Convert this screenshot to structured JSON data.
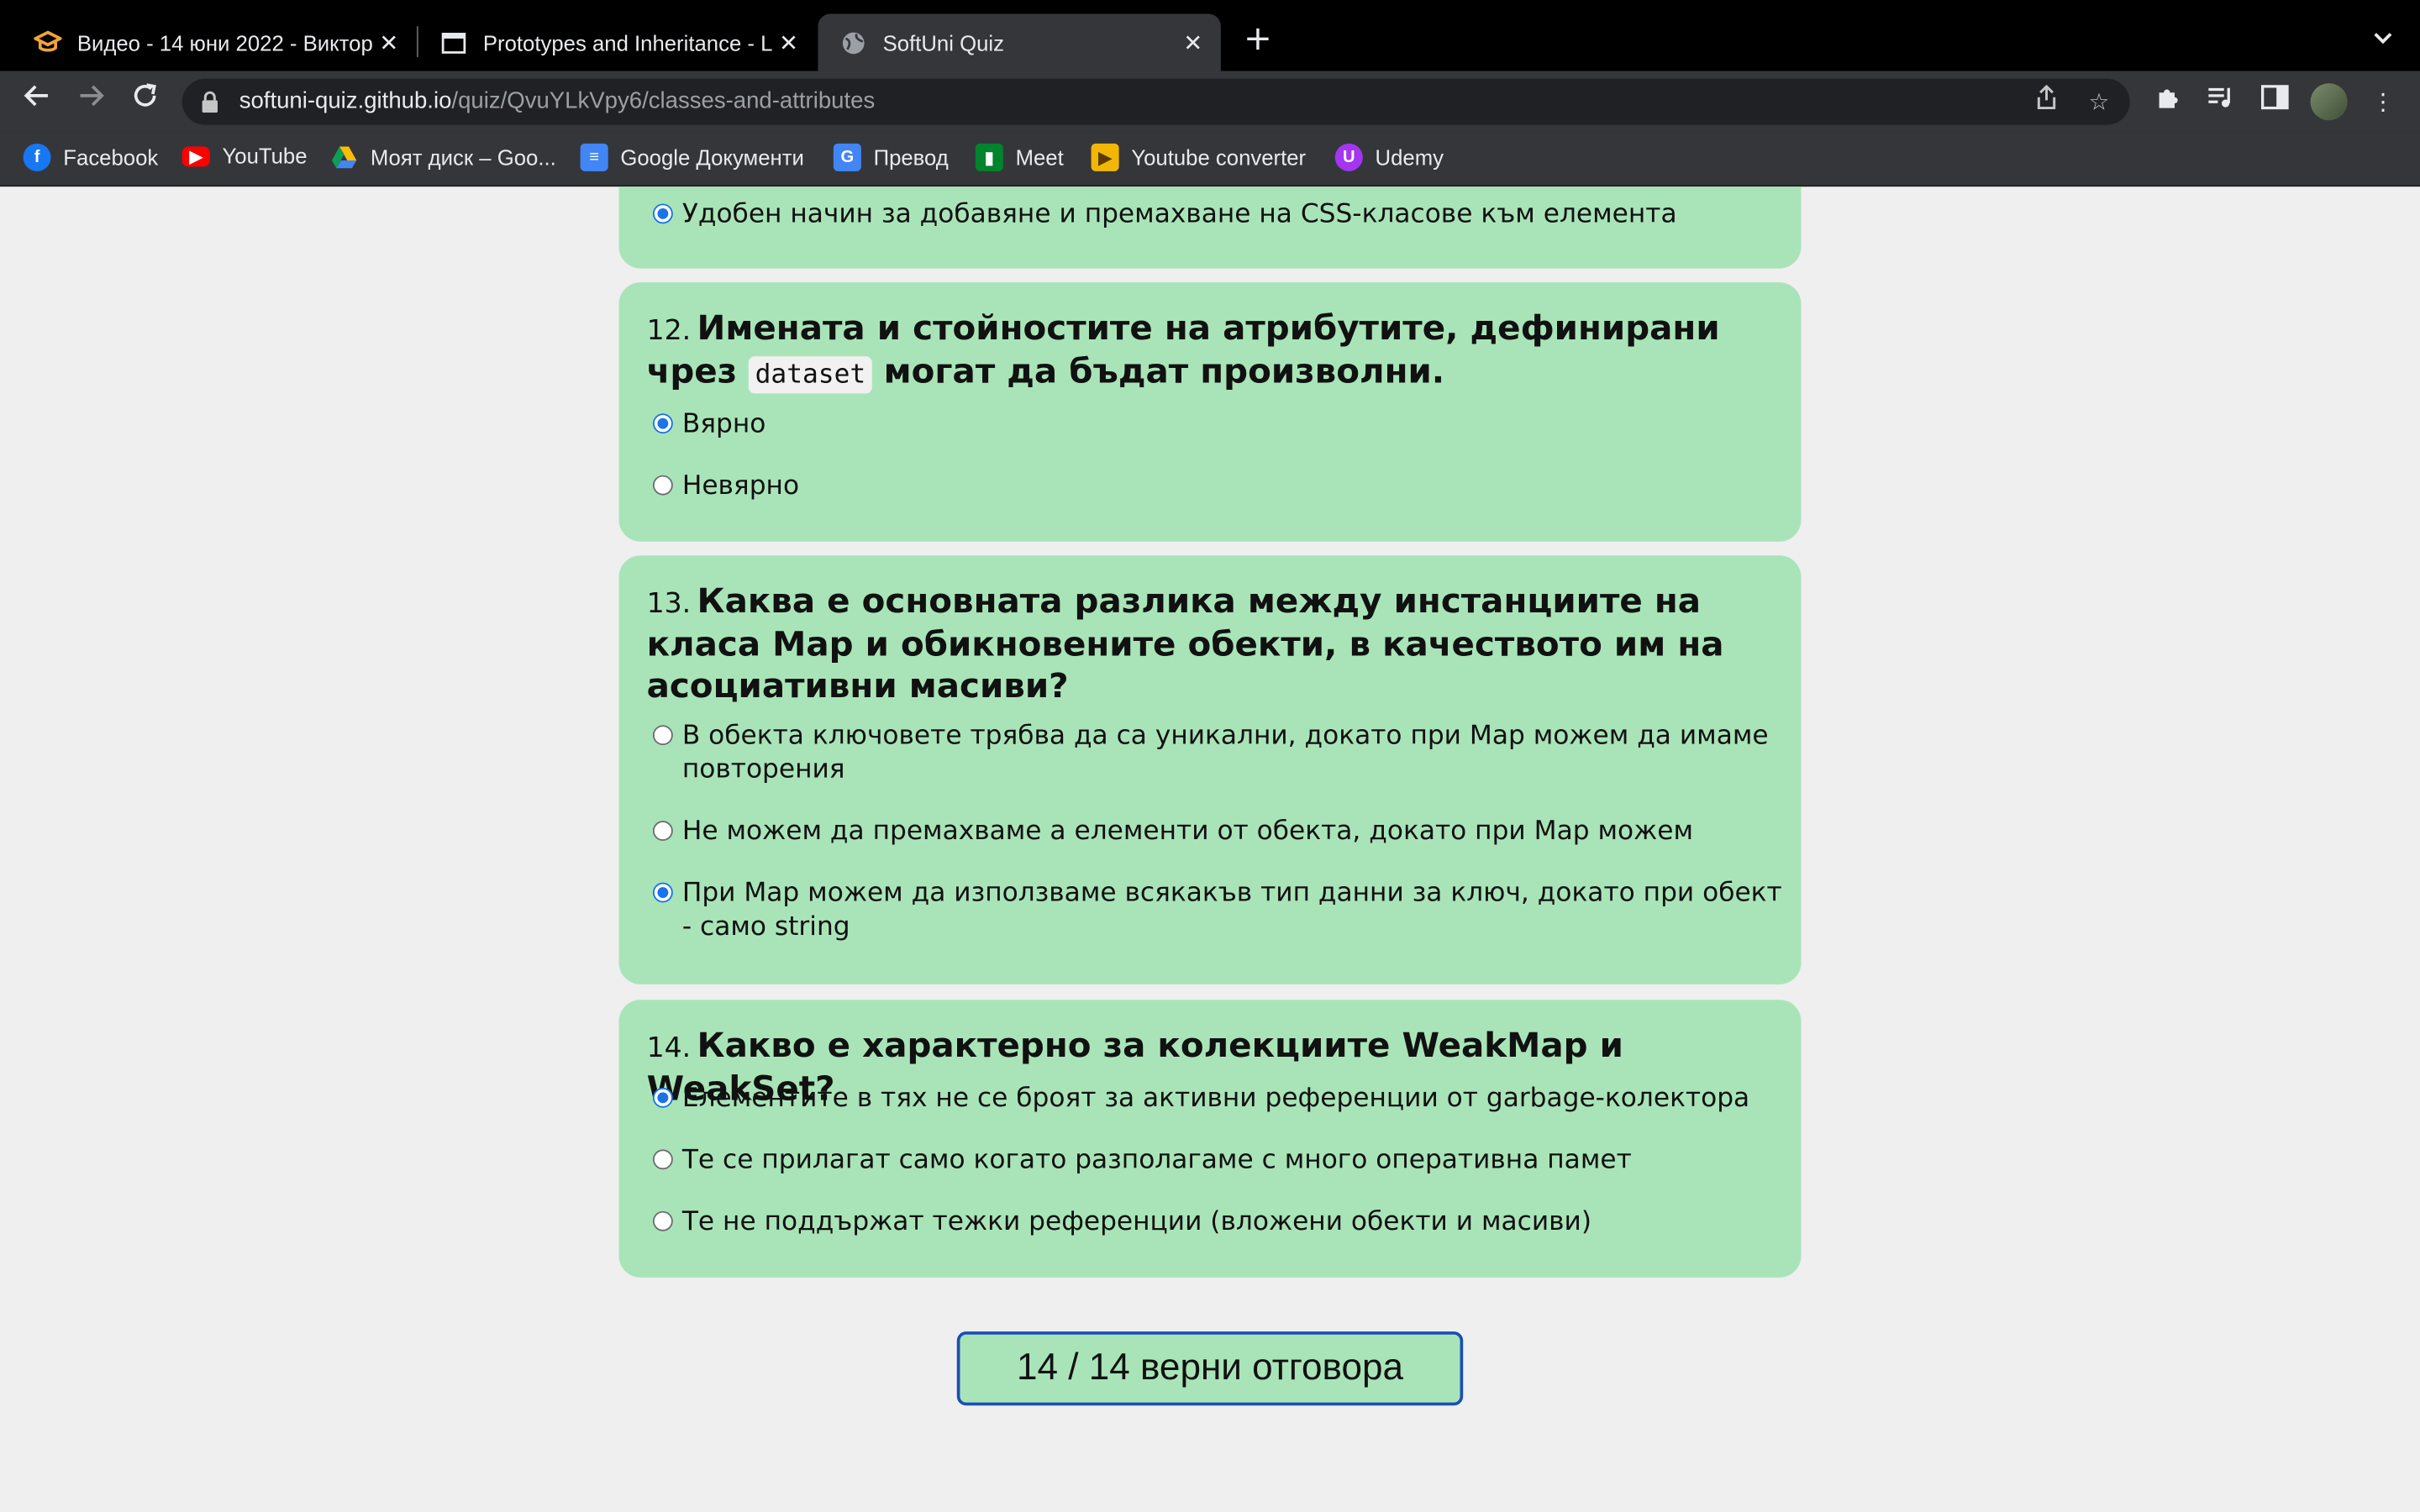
{
  "browser": {
    "tabs": [
      {
        "title": "Видео - 14 юни 2022 - Виктор",
        "favicon": "graduation-cap-icon"
      },
      {
        "title": "Prototypes and Inheritance - La",
        "favicon": "page-icon"
      },
      {
        "title": "SoftUni Quiz",
        "favicon": "globe-icon"
      }
    ],
    "url_host": "softuni-quiz.github.io",
    "url_path": "/quiz/QvuYLkVpy6/classes-and-attributes",
    "bookmarks": [
      "Facebook",
      "YouTube",
      "Моят диск – Goo...",
      "Google Документи",
      "Превод",
      "Meet",
      "Youtube converter",
      "Udemy"
    ]
  },
  "quiz": {
    "q11": {
      "options": [
        {
          "text": "Удобен начин за добавяне и премахване на CSS-класове към елемента",
          "checked": true
        }
      ]
    },
    "q12": {
      "number": "12.",
      "text_before": "Имената и стойностите на атрибутите, дефинирани чрез",
      "code": "dataset",
      "text_after": "могат да бъдат произволни.",
      "options": [
        {
          "text": "Вярно",
          "checked": true
        },
        {
          "text": "Невярно",
          "checked": false
        }
      ]
    },
    "q13": {
      "number": "13.",
      "text": "Каква е основната разлика между инстанциите на класа Map и обикновените обекти, в качеството им на асоциативни масиви?",
      "options": [
        {
          "text": "В обекта ключовете трябва да са уникални, докато при Map можем да имаме повторения",
          "checked": false
        },
        {
          "text": "Не можем да премахваме а елементи от обекта, докато при Map можем",
          "checked": false
        },
        {
          "text": "При Map можем да използваме всякакъв тип данни за ключ, докато при обект - само string",
          "checked": true
        }
      ]
    },
    "q14": {
      "number": "14.",
      "text": "Какво е характерно за колекциите WeakMap и WeakSet?",
      "options": [
        {
          "text": "Елементите в тях не се броят за активни референции от garbage-колектора",
          "checked": true
        },
        {
          "text": "Те се прилагат само когато разполагаме с много оперативна памет",
          "checked": false
        },
        {
          "text": "Те не поддържат тежки референции (вложени обекти и масиви)",
          "checked": false
        }
      ]
    },
    "score": "14 / 14 верни отговора"
  },
  "colors": {
    "card_bg": "#a9e4b8",
    "page_bg": "#efefef",
    "radio_checked": "#1a73e8",
    "score_border": "#1a4fb4"
  }
}
